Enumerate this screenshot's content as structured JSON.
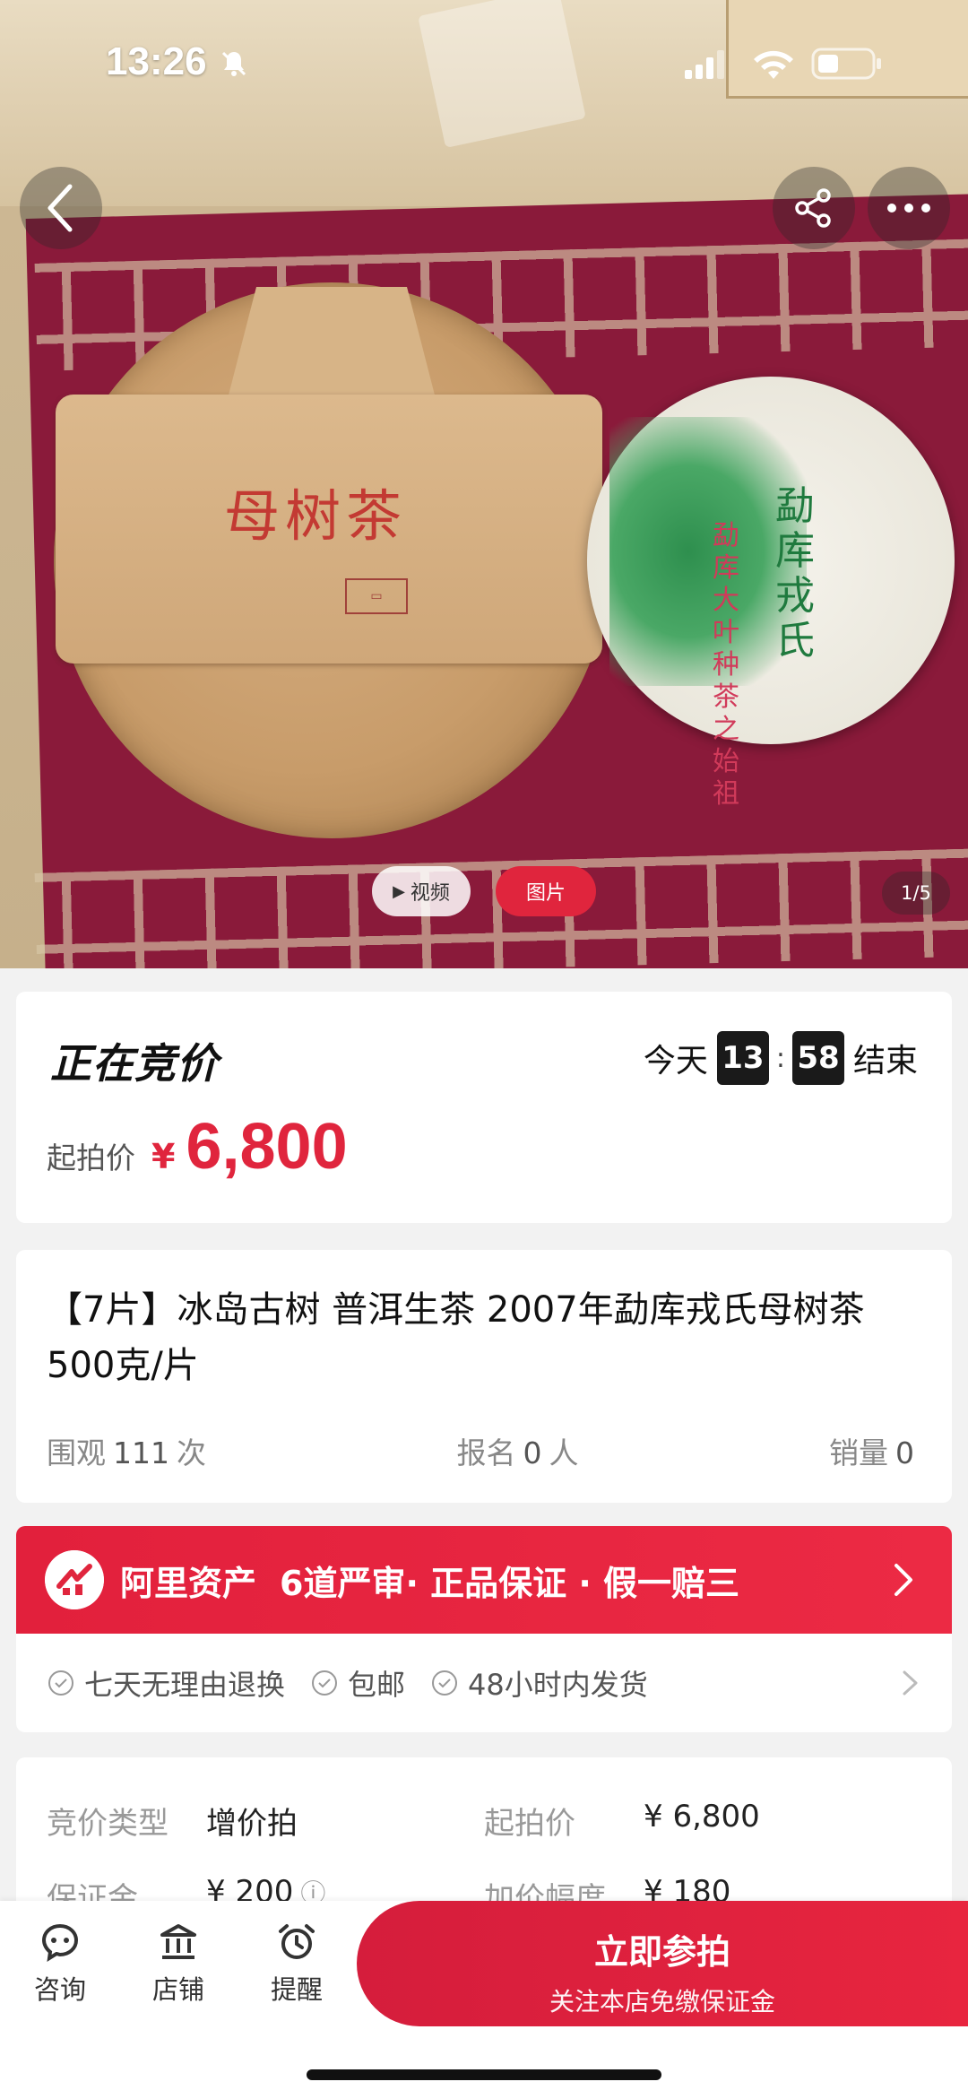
{
  "status_bar": {
    "time": "13:26"
  },
  "gallery": {
    "video_tab": "视频",
    "photo_tab": "图片",
    "pager": "1/5",
    "photo_stamp": "母树茶",
    "cake_label": "勐库戎氏",
    "cake_label2": "勐库大叶种茶之始祖"
  },
  "auction": {
    "status_title": "正在竞价",
    "ends_prefix": "今天",
    "end_hour": "13",
    "end_min": "58",
    "ends_suffix": "结束",
    "start_price_label": "起拍价",
    "currency": "¥",
    "start_price": "6,800"
  },
  "product": {
    "title": "【7片】冰岛古树 普洱生茶 2007年勐库戎氏母树茶 500克/片",
    "views_label": "围观",
    "views": "111",
    "views_unit": "次",
    "signups_label": "报名",
    "signups": "0",
    "signups_unit": "人",
    "sales_label": "销量",
    "sales": "0"
  },
  "assurance": {
    "brand": "阿里资产",
    "desc": "6道严审· 正品保证 · 假一赔三",
    "items": [
      "七天无理由退换",
      "包邮",
      "48小时内发货"
    ]
  },
  "details": {
    "type_label": "竞价类型",
    "type_value": "增价拍",
    "start_label": "起拍价",
    "start_value": "¥ 6,800",
    "deposit_label": "保证金",
    "deposit_value": "¥ 200",
    "increment_label": "加价幅度",
    "increment_value": "¥ 180"
  },
  "bottom_nav": {
    "consult": "咨询",
    "shop": "店铺",
    "remind": "提醒",
    "cta_main": "立即参拍",
    "cta_sub": "关注本店免缴保证金"
  },
  "colors": {
    "accent": "#e0253d",
    "icon": "#333333"
  }
}
